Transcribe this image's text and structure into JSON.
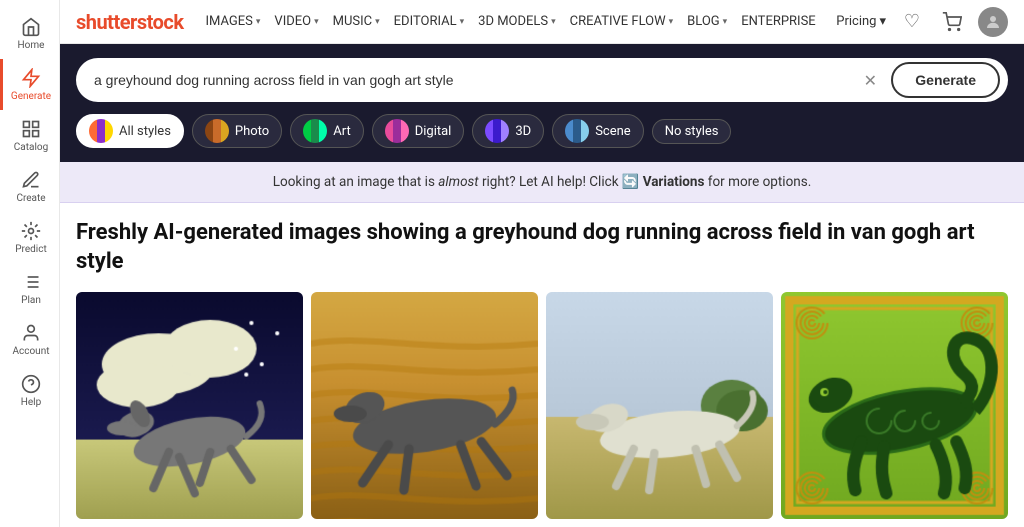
{
  "logo": {
    "text": "shutterstock"
  },
  "nav": {
    "links": [
      {
        "label": "IMAGES",
        "has_dropdown": true
      },
      {
        "label": "VIDEO",
        "has_dropdown": true
      },
      {
        "label": "MUSIC",
        "has_dropdown": true
      },
      {
        "label": "EDITORIAL",
        "has_dropdown": true
      },
      {
        "label": "3D MODELS",
        "has_dropdown": true
      },
      {
        "label": "CREATIVE FLOW",
        "has_dropdown": true
      },
      {
        "label": "BLOG",
        "has_dropdown": true
      },
      {
        "label": "ENTERPRISE",
        "has_dropdown": false
      }
    ],
    "pricing": "Pricing",
    "icons": {
      "heart": "♡",
      "cart": "🛒",
      "user": "👤"
    }
  },
  "search": {
    "placeholder": "a greyhound dog running across field in van gogh art style",
    "value": "a greyhound dog running across field in van gogh art style",
    "generate_label": "Generate",
    "clear_icon": "✕"
  },
  "style_pills": [
    {
      "label": "All styles",
      "active": true,
      "color1": "#ff6b35",
      "color2": "#8b5cf6"
    },
    {
      "label": "Photo",
      "active": false,
      "color1": "#c96b2a",
      "color2": "#8b4513"
    },
    {
      "label": "Art",
      "active": false,
      "color1": "#1a8b4b",
      "color2": "#00ffaa"
    },
    {
      "label": "Digital",
      "active": false,
      "color1": "#e84b9b",
      "color2": "#9b2d9b"
    },
    {
      "label": "3D",
      "active": false,
      "color1": "#7b4bff",
      "color2": "#3b1bcc"
    },
    {
      "label": "Scene",
      "active": false,
      "color1": "#4b8bcc",
      "color2": "#2b5b8b"
    },
    {
      "label": "No styles",
      "active": false,
      "color1": null,
      "color2": null
    }
  ],
  "info_banner": {
    "text_before": "Looking at an image that is ",
    "text_italic": "almost",
    "text_after": " right? Let AI help! Click ",
    "variations_label": "Variations",
    "text_end": " for more options."
  },
  "results": {
    "title": "Freshly AI-generated images showing a greyhound dog running across field in van gogh art style",
    "images": [
      {
        "id": 1,
        "bg": "#0a0a2e",
        "description": "greyhound dark night sky painting"
      },
      {
        "id": 2,
        "bg": "#b8860b",
        "description": "greyhound golden field painting"
      },
      {
        "id": 3,
        "bg": "#c8b87a",
        "description": "greyhound impressionist field"
      },
      {
        "id": 4,
        "bg": "#5a8c2a",
        "description": "greyhound celtic art green"
      }
    ]
  },
  "sidebar": {
    "items": [
      {
        "label": "Home",
        "icon": "⊞",
        "active": false
      },
      {
        "label": "Generate",
        "icon": "✦",
        "active": true
      },
      {
        "label": "Catalog",
        "icon": "▦",
        "active": false
      },
      {
        "label": "Create",
        "icon": "✏",
        "active": false
      },
      {
        "label": "Predict",
        "icon": "◈",
        "active": false
      },
      {
        "label": "Plan",
        "icon": "☰",
        "active": false
      },
      {
        "label": "Account",
        "icon": "⊙",
        "active": false
      },
      {
        "label": "Help",
        "icon": "?",
        "active": false
      }
    ]
  }
}
